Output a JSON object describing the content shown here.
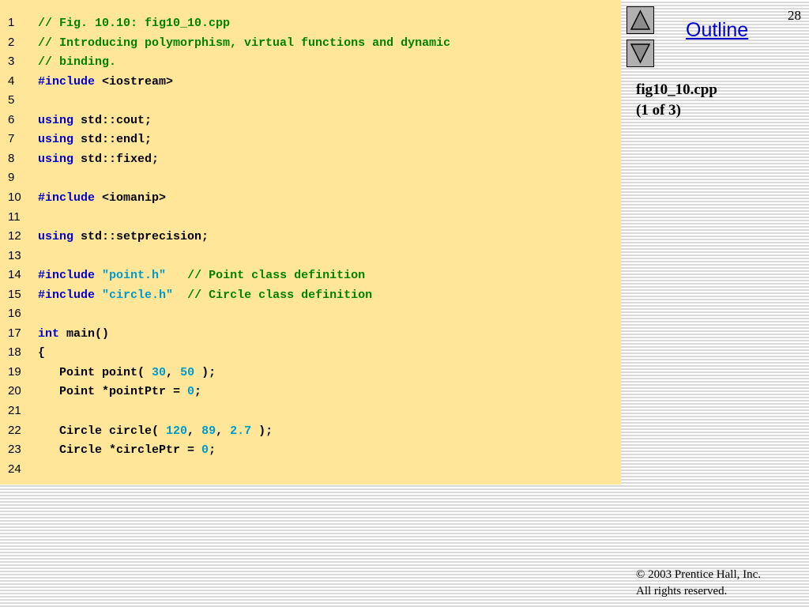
{
  "slide": {
    "page_number": "28",
    "outline_label": "Outline",
    "file_name": "fig10_10.cpp",
    "file_part": "(1 of 3)",
    "copyright_line1": "© 2003 Prentice Hall, Inc.",
    "copyright_line2": "All rights reserved."
  },
  "nav": {
    "up_icon": "triangle-up-icon",
    "down_icon": "triangle-down-icon"
  },
  "colors": {
    "code_bg": "#ffe699",
    "comment": "#008000",
    "keyword": "#0000cc",
    "literal": "#0099cc",
    "outline_link": "#0000cc"
  },
  "code_lines": [
    {
      "num": "1",
      "tokens": [
        {
          "t": "comment",
          "v": "// Fig. 10.10: fig10_10.cpp"
        }
      ]
    },
    {
      "num": "2",
      "tokens": [
        {
          "t": "comment",
          "v": "// Introducing polymorphism, virtual functions and dynamic"
        }
      ]
    },
    {
      "num": "3",
      "tokens": [
        {
          "t": "comment",
          "v": "// binding."
        }
      ]
    },
    {
      "num": "4",
      "tokens": [
        {
          "t": "keyword",
          "v": "#include"
        },
        {
          "t": "plain",
          "v": " <iostream>"
        }
      ]
    },
    {
      "num": "5",
      "tokens": []
    },
    {
      "num": "6",
      "tokens": [
        {
          "t": "keyword",
          "v": "using"
        },
        {
          "t": "plain",
          "v": " std::cout;"
        }
      ]
    },
    {
      "num": "7",
      "tokens": [
        {
          "t": "keyword",
          "v": "using"
        },
        {
          "t": "plain",
          "v": " std::endl;"
        }
      ]
    },
    {
      "num": "8",
      "tokens": [
        {
          "t": "keyword",
          "v": "using"
        },
        {
          "t": "plain",
          "v": " std::fixed;"
        }
      ]
    },
    {
      "num": "9",
      "tokens": []
    },
    {
      "num": "10",
      "tokens": [
        {
          "t": "keyword",
          "v": "#include"
        },
        {
          "t": "plain",
          "v": " <iomanip>"
        }
      ]
    },
    {
      "num": "11",
      "tokens": []
    },
    {
      "num": "12",
      "tokens": [
        {
          "t": "keyword",
          "v": "using"
        },
        {
          "t": "plain",
          "v": " std::setprecision;"
        }
      ]
    },
    {
      "num": "13",
      "tokens": []
    },
    {
      "num": "14",
      "tokens": [
        {
          "t": "keyword",
          "v": "#include"
        },
        {
          "t": "plain",
          "v": " "
        },
        {
          "t": "string",
          "v": "\"point.h\""
        },
        {
          "t": "plain",
          "v": "   "
        },
        {
          "t": "comment",
          "v": "// Point class definition"
        }
      ]
    },
    {
      "num": "15",
      "tokens": [
        {
          "t": "keyword",
          "v": "#include"
        },
        {
          "t": "plain",
          "v": " "
        },
        {
          "t": "string",
          "v": "\"circle.h\""
        },
        {
          "t": "plain",
          "v": "  "
        },
        {
          "t": "comment",
          "v": "// Circle class definition"
        }
      ]
    },
    {
      "num": "16",
      "tokens": []
    },
    {
      "num": "17",
      "tokens": [
        {
          "t": "keyword",
          "v": "int"
        },
        {
          "t": "plain",
          "v": " main()"
        }
      ]
    },
    {
      "num": "18",
      "tokens": [
        {
          "t": "plain",
          "v": "{"
        }
      ]
    },
    {
      "num": "19",
      "tokens": [
        {
          "t": "plain",
          "v": "   Point point( "
        },
        {
          "t": "number",
          "v": "30"
        },
        {
          "t": "plain",
          "v": ", "
        },
        {
          "t": "number",
          "v": "50"
        },
        {
          "t": "plain",
          "v": " );"
        }
      ]
    },
    {
      "num": "20",
      "tokens": [
        {
          "t": "plain",
          "v": "   Point *pointPtr = "
        },
        {
          "t": "number",
          "v": "0"
        },
        {
          "t": "plain",
          "v": ";"
        }
      ]
    },
    {
      "num": "21",
      "tokens": []
    },
    {
      "num": "22",
      "tokens": [
        {
          "t": "plain",
          "v": "   Circle circle( "
        },
        {
          "t": "number",
          "v": "120"
        },
        {
          "t": "plain",
          "v": ", "
        },
        {
          "t": "number",
          "v": "89"
        },
        {
          "t": "plain",
          "v": ", "
        },
        {
          "t": "number",
          "v": "2.7"
        },
        {
          "t": "plain",
          "v": " );"
        }
      ]
    },
    {
      "num": "23",
      "tokens": [
        {
          "t": "plain",
          "v": "   Circle *circlePtr = "
        },
        {
          "t": "number",
          "v": "0"
        },
        {
          "t": "plain",
          "v": ";"
        }
      ]
    },
    {
      "num": "24",
      "tokens": []
    }
  ]
}
